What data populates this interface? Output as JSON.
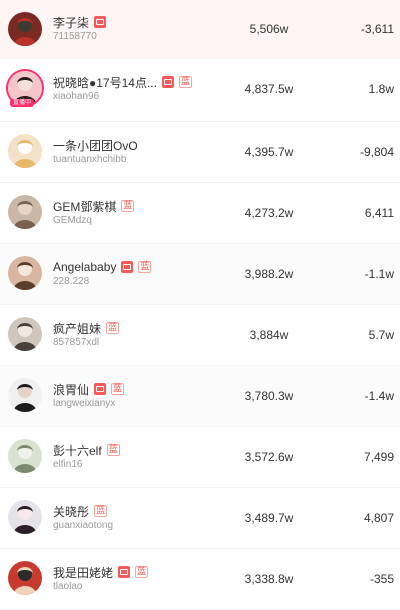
{
  "rows": [
    {
      "name": "李子柒",
      "handle": "71158770",
      "fans": "5,506w",
      "change": "-3,611",
      "badges": [
        "a"
      ],
      "live": false,
      "icon": "avatar-red-figure"
    },
    {
      "name": "祝晓晗●17号14点...",
      "handle": "xiaohan96",
      "fans": "4,837.5w",
      "change": "1.8w",
      "badges": [
        "a",
        "b"
      ],
      "live": true,
      "live_label": "直播中",
      "icon": "avatar-girl-pink"
    },
    {
      "name": "一条小团团OvO",
      "handle": "tuantuanxhchibb",
      "fans": "4,395.7w",
      "change": "-9,804",
      "badges": [],
      "live": false,
      "icon": "avatar-cartoon"
    },
    {
      "name": "GEM鄧紫棋",
      "handle": "GEMdzq",
      "fans": "4,273.2w",
      "change": "6,411",
      "badges": [
        "b"
      ],
      "live": false,
      "icon": "avatar-singer"
    },
    {
      "name": "Angelababy",
      "handle": "228.228",
      "fans": "3,988.2w",
      "change": "-1.1w",
      "badges": [
        "a",
        "b"
      ],
      "live": false,
      "icon": "avatar-actress"
    },
    {
      "name": "疯产姐妹",
      "handle": "857857xdl",
      "fans": "3,884w",
      "change": "5.7w",
      "badges": [
        "b"
      ],
      "live": false,
      "icon": "avatar-sisters"
    },
    {
      "name": "浪胃仙",
      "handle": "langweixianyx",
      "fans": "3,780.3w",
      "change": "-1.4w",
      "badges": [
        "a",
        "b"
      ],
      "live": false,
      "icon": "avatar-girl-black"
    },
    {
      "name": "彭十六elf",
      "handle": "elfin16",
      "fans": "3,572.6w",
      "change": "7,499",
      "badges": [
        "b"
      ],
      "live": false,
      "icon": "avatar-outdoor"
    },
    {
      "name": "关晓彤",
      "handle": "guanxiaotong",
      "fans": "3,489.7w",
      "change": "4,807",
      "badges": [
        "b"
      ],
      "live": false,
      "icon": "avatar-portrait"
    },
    {
      "name": "我是田姥姥",
      "handle": "tlaolao",
      "fans": "3,338.8w",
      "change": "-355",
      "badges": [
        "a",
        "b"
      ],
      "live": false,
      "icon": "avatar-grandma"
    }
  ],
  "badge_b_label": "蓝",
  "colors": {
    "accent": "#f45a5a",
    "first_row_bg": "#fff5f4",
    "live": "#ff2d6b"
  }
}
